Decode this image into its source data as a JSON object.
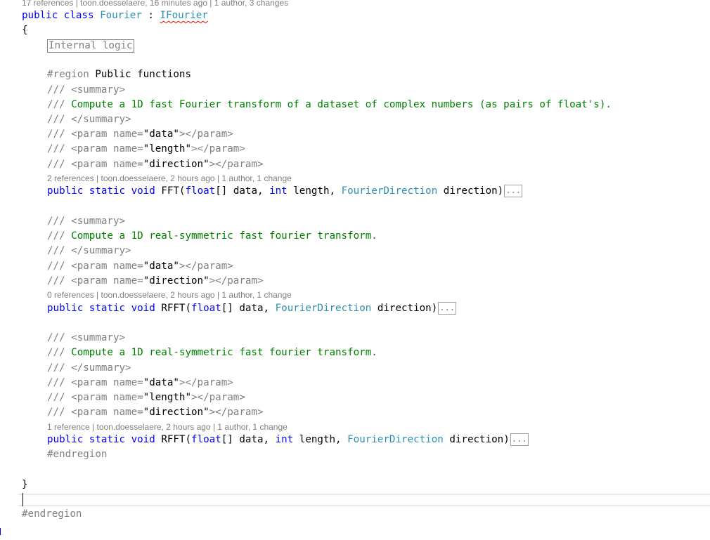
{
  "lenses": {
    "class_lens": "17 references | toon.doesselaere, 16 minutes ago | 1 author, 3 changes",
    "fft_lens": "2 references | toon.doesselaere, 2 hours ago | 1 author, 1 change",
    "rfft1_lens": "0 references | toon.doesselaere, 2 hours ago | 1 author, 1 change",
    "rfft2_lens": "1 reference | toon.doesselaere, 2 hours ago | 1 author, 1 change"
  },
  "class_decl": {
    "kw1": "public",
    "kw2": "class",
    "name": "Fourier",
    "sep": " : ",
    "iface": "IFourier"
  },
  "braces": {
    "open": "{",
    "close": "}"
  },
  "collapsed": {
    "internal_logic": "Internal logic"
  },
  "region": {
    "start_kw": "#region",
    "start_name": " Public functions",
    "end": "#endregion",
    "outer_end": "#endregion"
  },
  "doc": {
    "slashes": "/// ",
    "summary_open": "<summary>",
    "summary_close": "</summary>",
    "fft_summary": "Compute a 1D fast Fourier transform of a dataset of complex numbers (as pairs of float's).",
    "rfft_summary": "Compute a 1D real-symmetric fast fourier transform.",
    "param_open": "<param name=",
    "param_close": "></param>",
    "p_data": "\"data\"",
    "p_length": "\"length\"",
    "p_direction": "\"direction\""
  },
  "methods": {
    "public": "public",
    "static": "static",
    "void": "void",
    "fft_name": "FFT(",
    "rfft_name": "RFFT(",
    "float": "float",
    "arr_data": "[] data, ",
    "int": "int",
    "length": " length, ",
    "dir_type": "FourierDirection",
    "dir_tail": " direction)",
    "ellipsis": "..."
  }
}
